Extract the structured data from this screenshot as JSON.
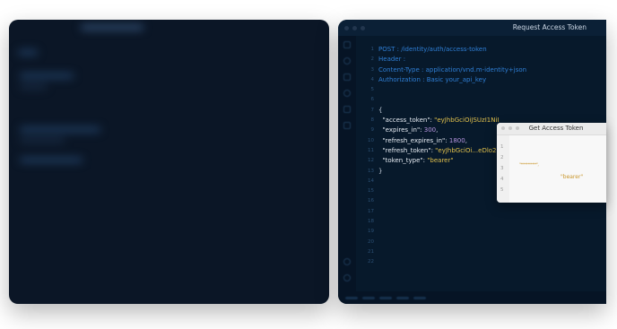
{
  "editor": {
    "title": "Request Access Token",
    "lines": [
      {
        "n": "1",
        "parts": [
          {
            "t": "POST : /identity/auth/access-token",
            "c": "blue"
          }
        ]
      },
      {
        "n": "2",
        "parts": [
          {
            "t": "Header :",
            "c": "blue"
          }
        ]
      },
      {
        "n": "3",
        "parts": [
          {
            "t": "Content-Type : application/vnd.m-identity+json",
            "c": "blue"
          }
        ]
      },
      {
        "n": "4",
        "parts": [
          {
            "t": "Authorization : Basic your_api_key",
            "c": "blue"
          }
        ]
      },
      {
        "n": "5",
        "parts": []
      },
      {
        "n": "6",
        "parts": []
      },
      {
        "n": "7",
        "parts": [
          {
            "t": "{",
            "c": "punc"
          }
        ]
      },
      {
        "n": "8",
        "parts": [
          {
            "t": "  \"access_token\": ",
            "c": "key"
          },
          {
            "t": "\"eyJhbGciOiJSUzI1NiI",
            "c": "str"
          }
        ]
      },
      {
        "n": "9",
        "parts": [
          {
            "t": "  \"expires_in\": ",
            "c": "key"
          },
          {
            "t": "300",
            "c": "num"
          },
          {
            "t": ",",
            "c": "punc"
          }
        ]
      },
      {
        "n": "10",
        "parts": [
          {
            "t": "  \"refresh_expires_in\": ",
            "c": "key"
          },
          {
            "t": "1800",
            "c": "num"
          },
          {
            "t": ",",
            "c": "punc"
          }
        ]
      },
      {
        "n": "11",
        "parts": [
          {
            "t": "  \"refresh_token\": ",
            "c": "key"
          },
          {
            "t": "\"eyJhbGciOi...eDlo2",
            "c": "str"
          }
        ]
      },
      {
        "n": "12",
        "parts": [
          {
            "t": "  \"token_type\": ",
            "c": "key"
          },
          {
            "t": "\"bearer\"",
            "c": "str"
          }
        ]
      },
      {
        "n": "13",
        "parts": [
          {
            "t": "}",
            "c": "punc"
          }
        ]
      },
      {
        "n": "14",
        "parts": []
      },
      {
        "n": "15",
        "parts": []
      },
      {
        "n": "16",
        "parts": []
      },
      {
        "n": "17",
        "parts": []
      },
      {
        "n": "18",
        "parts": []
      },
      {
        "n": "19",
        "parts": []
      },
      {
        "n": "20",
        "parts": []
      },
      {
        "n": "21",
        "parts": []
      },
      {
        "n": "22",
        "parts": []
      }
    ]
  },
  "popup": {
    "title": "Get Access Token",
    "line_numbers": [
      "1",
      "2",
      "3",
      "4",
      "5"
    ],
    "masked_value": "\"***********\",",
    "token_type_value": "\"bearer\""
  },
  "colors": {
    "editor_bg": "#07192b",
    "keyword_blue": "#2f7fd6",
    "string_yellow": "#e0c04c",
    "number_purple": "#b795e0"
  }
}
